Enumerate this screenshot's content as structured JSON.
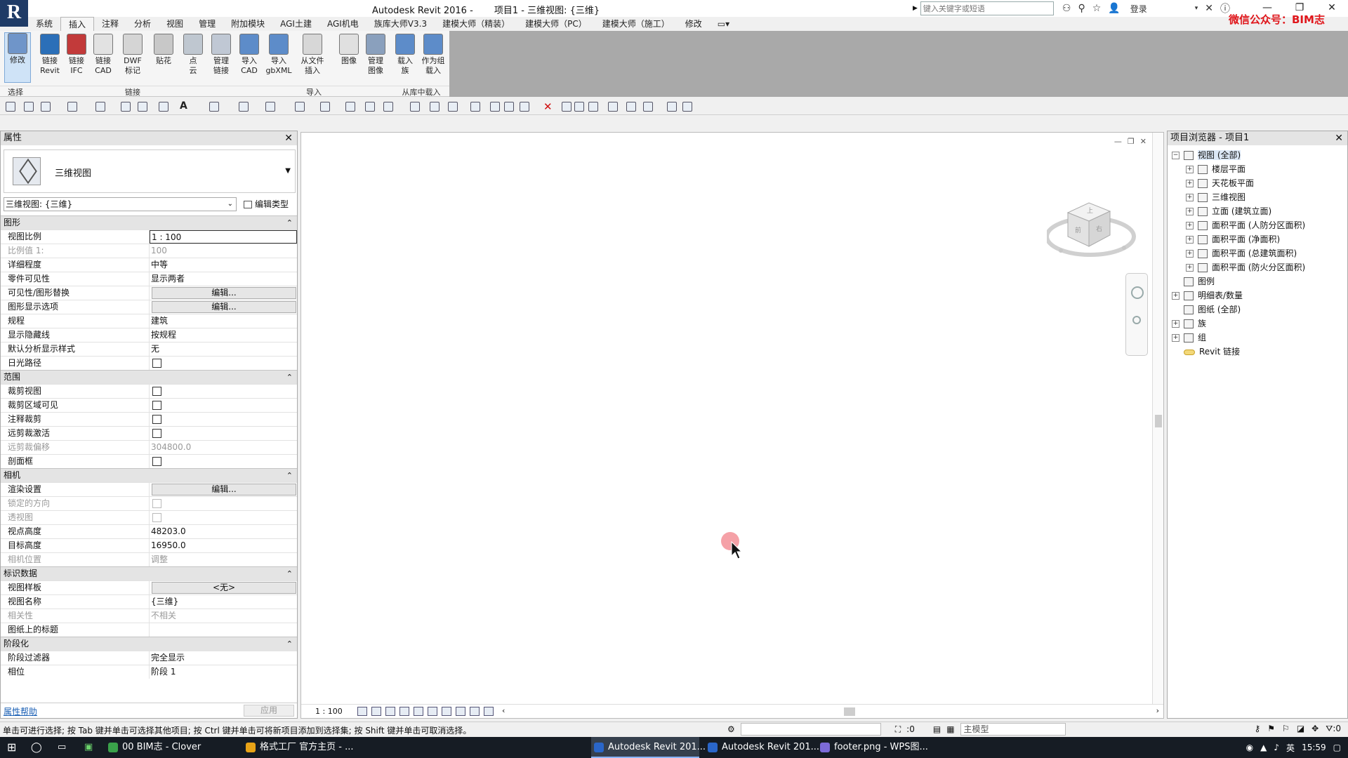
{
  "window": {
    "app_title": "Autodesk Revit 2016 -",
    "doc_title": "项目1 - 三维视图: {三维}",
    "search_placeholder": "键入关键字或短语",
    "login": "登录",
    "watermark": "微信公众号：BIM志"
  },
  "menu": {
    "tabs": [
      "系统",
      "插入",
      "注释",
      "分析",
      "视图",
      "管理",
      "附加模块",
      "AGI土建",
      "AGI机电",
      "族库大师V3.3",
      "建模大师（精装）",
      "建模大师（PC）",
      "建模大师（施工）",
      "修改"
    ],
    "active": "插入"
  },
  "ribbon": {
    "buttons": [
      {
        "label": "修改",
        "icon": "modify-icon"
      },
      {
        "label": "链接\nRevit",
        "icon": "link-revit-icon"
      },
      {
        "label": "链接\nIFC",
        "icon": "link-ifc-icon"
      },
      {
        "label": "链接\nCAD",
        "icon": "link-cad-icon"
      },
      {
        "label": "DWF\n标记",
        "icon": "dwf-icon"
      },
      {
        "label": "贴花",
        "icon": "decal-icon"
      },
      {
        "label": "点\n云",
        "icon": "point-cloud-icon"
      },
      {
        "label": "管理\n链接",
        "icon": "manage-links-icon"
      },
      {
        "label": "导入\nCAD",
        "icon": "import-cad-icon"
      },
      {
        "label": "导入\ngbXML",
        "icon": "import-gbxml-icon"
      },
      {
        "label": "从文件\n插入",
        "icon": "insert-from-file-icon"
      },
      {
        "label": "图像",
        "icon": "image-icon"
      },
      {
        "label": "管理\n图像",
        "icon": "manage-images-icon"
      },
      {
        "label": "载入\n族",
        "icon": "load-family-icon"
      },
      {
        "label": "作为组\n载入",
        "icon": "load-as-group-icon"
      }
    ],
    "groups": [
      "选择",
      "链接",
      "导入",
      "从库中载入"
    ]
  },
  "properties": {
    "title": "属性",
    "type_name": "三维视图",
    "view_selector": "三维视图: {三维}",
    "edit_type": "编辑类型",
    "sections": [
      {
        "name": "图形",
        "rows": [
          {
            "label": "视图比例",
            "value": "1 : 100",
            "kind": "input"
          },
          {
            "label": "比例值 1:",
            "value": "100",
            "kind": "text",
            "disabled": true
          },
          {
            "label": "详细程度",
            "value": "中等",
            "kind": "text"
          },
          {
            "label": "零件可见性",
            "value": "显示两者",
            "kind": "text"
          },
          {
            "label": "可见性/图形替换",
            "value": "编辑...",
            "kind": "button"
          },
          {
            "label": "图形显示选项",
            "value": "编辑...",
            "kind": "button"
          },
          {
            "label": "规程",
            "value": "建筑",
            "kind": "text"
          },
          {
            "label": "显示隐藏线",
            "value": "按规程",
            "kind": "text"
          },
          {
            "label": "默认分析显示样式",
            "value": "无",
            "kind": "text"
          },
          {
            "label": "日光路径",
            "value": "",
            "kind": "checkbox"
          }
        ]
      },
      {
        "name": "范围",
        "rows": [
          {
            "label": "裁剪视图",
            "value": "",
            "kind": "checkbox"
          },
          {
            "label": "裁剪区域可见",
            "value": "",
            "kind": "checkbox"
          },
          {
            "label": "注释裁剪",
            "value": "",
            "kind": "checkbox"
          },
          {
            "label": "远剪裁激活",
            "value": "",
            "kind": "checkbox"
          },
          {
            "label": "远剪裁偏移",
            "value": "304800.0",
            "kind": "text",
            "disabled": true
          },
          {
            "label": "剖面框",
            "value": "",
            "kind": "checkbox"
          }
        ]
      },
      {
        "name": "相机",
        "rows": [
          {
            "label": "渲染设置",
            "value": "编辑...",
            "kind": "button"
          },
          {
            "label": "锁定的方向",
            "value": "",
            "kind": "checkbox",
            "disabled": true
          },
          {
            "label": "透视图",
            "value": "",
            "kind": "checkbox",
            "disabled": true
          },
          {
            "label": "视点高度",
            "value": "48203.0",
            "kind": "text"
          },
          {
            "label": "目标高度",
            "value": "16950.0",
            "kind": "text"
          },
          {
            "label": "相机位置",
            "value": "调整",
            "kind": "text",
            "disabled": true
          }
        ]
      },
      {
        "name": "标识数据",
        "rows": [
          {
            "label": "视图样板",
            "value": "<无>",
            "kind": "button"
          },
          {
            "label": "视图名称",
            "value": "{三维}",
            "kind": "text"
          },
          {
            "label": "相关性",
            "value": "不相关",
            "kind": "text",
            "disabled": true
          },
          {
            "label": "图纸上的标题",
            "value": "",
            "kind": "text"
          }
        ]
      },
      {
        "name": "阶段化",
        "rows": [
          {
            "label": "阶段过滤器",
            "value": "完全显示",
            "kind": "text"
          },
          {
            "label": "相位",
            "value": "阶段 1",
            "kind": "text"
          }
        ]
      }
    ],
    "help": "属性帮助",
    "apply": "应用"
  },
  "canvas": {
    "scale": "1 : 100"
  },
  "browser": {
    "title": "项目浏览器 - 项目1",
    "tree": [
      {
        "label": "视图 (全部)",
        "level": 1,
        "toggle": "−",
        "selected": true
      },
      {
        "label": "楼层平面",
        "level": 2,
        "toggle": "+"
      },
      {
        "label": "天花板平面",
        "level": 2,
        "toggle": "+"
      },
      {
        "label": "三维视图",
        "level": 2,
        "toggle": "+"
      },
      {
        "label": "立面 (建筑立面)",
        "level": 2,
        "toggle": "+"
      },
      {
        "label": "面积平面 (人防分区面积)",
        "level": 2,
        "toggle": "+"
      },
      {
        "label": "面积平面 (净面积)",
        "level": 2,
        "toggle": "+"
      },
      {
        "label": "面积平面 (总建筑面积)",
        "level": 2,
        "toggle": "+"
      },
      {
        "label": "面积平面 (防火分区面积)",
        "level": 2,
        "toggle": "+"
      },
      {
        "label": "图例",
        "level": 1,
        "toggle": ""
      },
      {
        "label": "明细表/数量",
        "level": 1,
        "toggle": "+"
      },
      {
        "label": "图纸 (全部)",
        "level": 1,
        "toggle": ""
      },
      {
        "label": "族",
        "level": 1,
        "toggle": "+"
      },
      {
        "label": "组",
        "level": 1,
        "toggle": "+"
      },
      {
        "label": "Revit 链接",
        "level": 1,
        "toggle": "",
        "link": true
      }
    ]
  },
  "status": {
    "message": "单击可进行选择; 按 Tab 键并单击可选择其他项目; 按 Ctrl 键并单击可将新项目添加到选择集; 按 Shift 键并单击可取消选择。",
    "count": ":0",
    "model": "主模型",
    "filter_count": ":0"
  },
  "taskbar": {
    "apps": [
      {
        "label": "00 BIM志 - Clover",
        "color": "#3aa14a"
      },
      {
        "label": "格式工厂 官方主页 - ...",
        "color": "#e8a317"
      },
      {
        "label": "Autodesk Revit 201...",
        "color": "#2a66c9",
        "active": true
      },
      {
        "label": "Autodesk Revit 201...",
        "color": "#2a66c9"
      },
      {
        "label": "footer.png - WPS图...",
        "color": "#7c6ad8"
      }
    ],
    "ime": "英",
    "time": "15:59"
  }
}
